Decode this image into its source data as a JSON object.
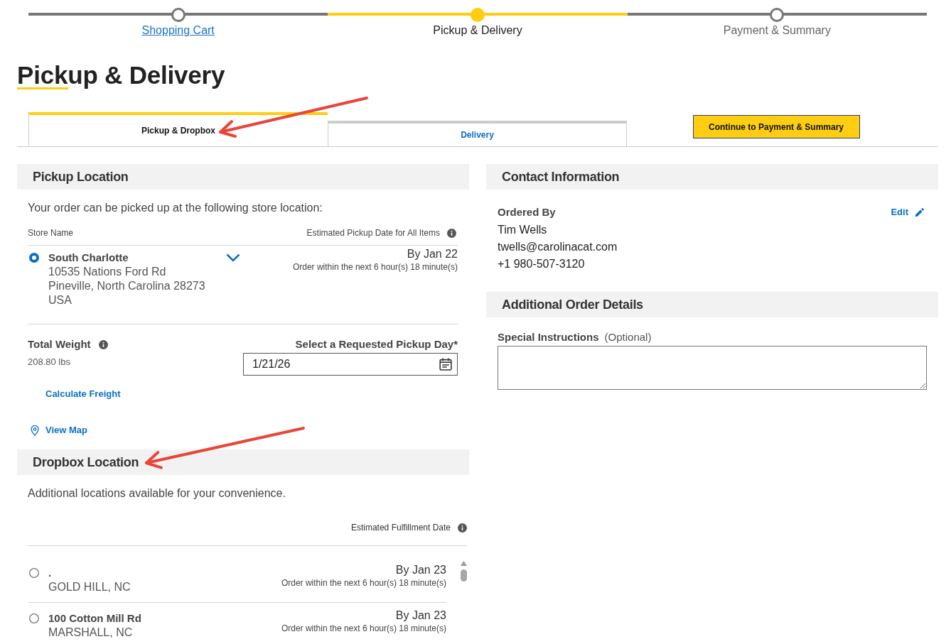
{
  "steps": [
    {
      "label": "Shopping Cart",
      "completed": true,
      "selected": false
    },
    {
      "label": "Pickup & Delivery",
      "completed": false,
      "selected": true
    },
    {
      "label": "Payment & Summary",
      "completed": false,
      "selected": false
    }
  ],
  "page_title": "Pickup & Delivery",
  "tabs": [
    {
      "label": "Pickup & Dropbox",
      "selected": true
    },
    {
      "label": "Delivery",
      "selected": false
    }
  ],
  "continue_button": "Continue to Payment & Summary",
  "pickup_location": {
    "heading": "Pickup Location",
    "intro": "Your order can be picked up at the following store location:",
    "columns": {
      "store_name": "Store Name",
      "pickup_date": "Estimated Pickup Date for All Items"
    },
    "store": {
      "name": "South Charlotte",
      "address_lines": [
        "10535 Nations Ford Rd",
        "Pineville, North Carolina 28273",
        "USA"
      ],
      "selected": true,
      "expanded": false,
      "date": "By Jan 22",
      "cutoff": "Order within the next 6 hour(s) 18 minute(s)"
    },
    "total_weight": {
      "label": "Total Weight",
      "value": "208.80 lbs"
    },
    "pickup_day": {
      "label": "Select a Requested Pickup Day*",
      "value": "1/21/26"
    },
    "calculate_freight": "Calculate Freight",
    "view_map": "View Map"
  },
  "dropbox_location": {
    "heading": "Dropbox Location",
    "intro": "Additional locations available for your convenience.",
    "date_column": "Estimated Fulfillment Date",
    "locations": [
      {
        "name": ".",
        "city": "GOLD HILL, NC",
        "selected": false,
        "date": "By Jan 23",
        "cutoff": "Order within the next 6 hour(s) 18 minute(s)"
      },
      {
        "name": "100 Cotton Mill Rd",
        "city": "MARSHALL, NC",
        "selected": false,
        "date": "By Jan 23",
        "cutoff": "Order within the next 6 hour(s) 18 minute(s)"
      }
    ]
  },
  "contact_information": {
    "heading": "Contact Information",
    "label": "Ordered By",
    "edit": "Edit",
    "name": "Tim Wells",
    "email": "twells@carolinacat.com",
    "phone": "+1 980-507-3120"
  },
  "additional_order_details": {
    "heading": "Additional Order Details",
    "label": "Special Instructions",
    "hint": "(Optional)"
  },
  "annotations": [
    {
      "kind": "arrow"
    },
    {
      "kind": "arrow"
    }
  ]
}
